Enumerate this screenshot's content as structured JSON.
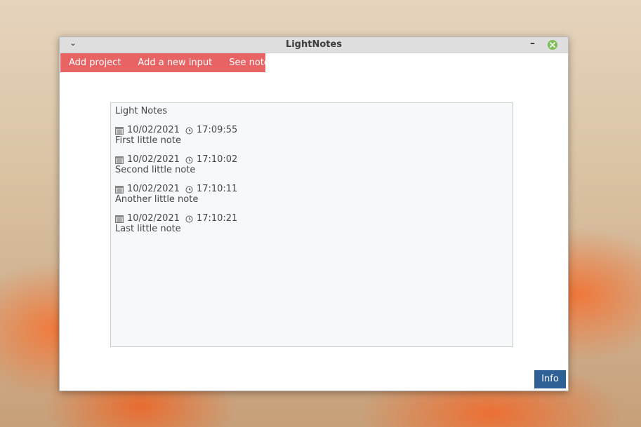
{
  "window": {
    "title": "LightNotes",
    "menu_glyph": "⌄",
    "minimize_glyph": "–"
  },
  "menubar": {
    "items": [
      {
        "label": "Add project"
      },
      {
        "label": "Add a new input"
      },
      {
        "label": "See notes"
      }
    ]
  },
  "notes_panel": {
    "title": "Light Notes",
    "notes": [
      {
        "date": "10/02/2021",
        "time": "17:09:55",
        "text": "First little note"
      },
      {
        "date": "10/02/2021",
        "time": "17:10:02",
        "text": "Second little note"
      },
      {
        "date": "10/02/2021",
        "time": "17:10:11",
        "text": "Another little note"
      },
      {
        "date": "10/02/2021",
        "time": "17:10:21",
        "text": "Last little note"
      }
    ]
  },
  "footer": {
    "info_label": "Info"
  },
  "colors": {
    "menubar": "#e86464",
    "info_button": "#2f6196",
    "close_button": "#7fbf5b"
  },
  "icons": {
    "date": "calendar-icon",
    "time": "clock-icon",
    "close": "close-icon"
  }
}
